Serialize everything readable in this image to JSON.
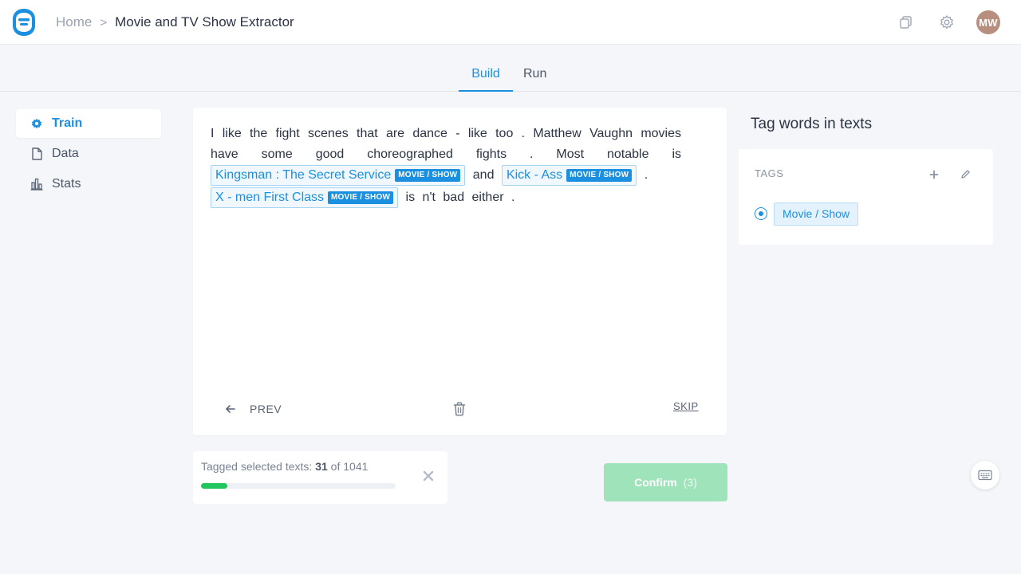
{
  "header": {
    "breadcrumb_home": "Home",
    "breadcrumb_sep": ">",
    "breadcrumb_current": "Movie and TV Show Extractor",
    "avatar_initials": "MW",
    "icons": [
      "logo-icon",
      "copy-icon",
      "gear-icon"
    ]
  },
  "tabs": [
    {
      "label": "Build",
      "active": true
    },
    {
      "label": "Run",
      "active": false
    }
  ],
  "sidebar": {
    "items": [
      {
        "label": "Train",
        "icon": "gear-icon",
        "active": true
      },
      {
        "label": "Data",
        "icon": "file-icon",
        "active": false
      },
      {
        "label": "Stats",
        "icon": "bar-chart-icon",
        "active": false
      }
    ]
  },
  "text": {
    "t1": "I like the fight scenes that are dance - like too . Matthew Vaughn movies have some good choreographed fights . Most notable is",
    "e1": "Kingsman : The Secret Service",
    "t2": "and",
    "e2": "Kick - Ass",
    "t3": ".",
    "e3": "X - men First Class",
    "t4": "is n't bad either .",
    "entity_tag": "MOVIE / SHOW"
  },
  "nav": {
    "prev_label": "PREV",
    "skip_label": "SKIP"
  },
  "progress": {
    "label": "Tagged selected texts:",
    "done": "31",
    "of": "of",
    "total": "1041",
    "fraction": 0.1344
  },
  "confirm": {
    "label": "Confirm",
    "count": "(3)"
  },
  "panel": {
    "title": "Tag words in texts",
    "tags_label": "TAGS",
    "tags": [
      {
        "label": "Movie / Show",
        "selected": true
      }
    ]
  },
  "colors": {
    "accent": "#1b8fe0",
    "confirm": "#9ee3b9",
    "progress": "#22c55e",
    "avatar": "#b88f7f"
  }
}
